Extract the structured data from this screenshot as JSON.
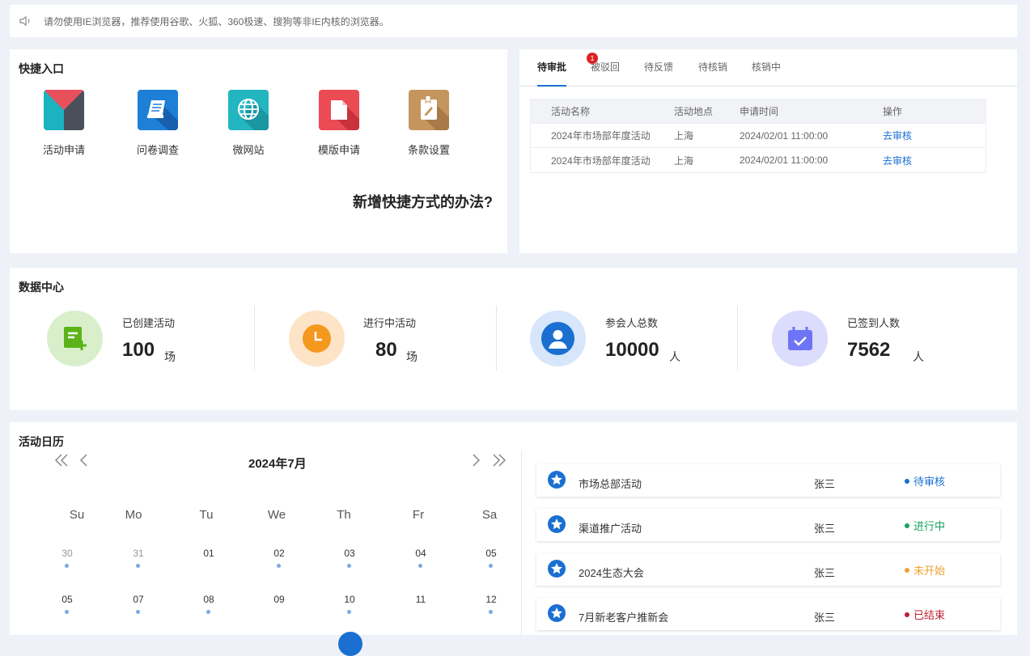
{
  "notice": {
    "text": "请勿使用IE浏览器，推荐使用谷歌、火狐、360极速、搜狗等非IE内核的浏览器。",
    "icon": "speaker-icon"
  },
  "quick": {
    "title": "快捷入口",
    "items": [
      {
        "label": "活动申请",
        "icon": "activity-icon"
      },
      {
        "label": "问卷调查",
        "icon": "survey-icon"
      },
      {
        "label": "微网站",
        "icon": "globe-icon"
      },
      {
        "label": "模版申请",
        "icon": "document-icon"
      },
      {
        "label": "条款设置",
        "icon": "terms-icon"
      }
    ],
    "how_link": "新增快捷方式的办法?"
  },
  "approval": {
    "tabs": [
      {
        "label": "待审批",
        "badge": "1",
        "active": true
      },
      {
        "label": "被驳回"
      },
      {
        "label": "待反馈"
      },
      {
        "label": "待核销"
      },
      {
        "label": "核销中"
      }
    ],
    "columns": [
      "活动名称",
      "活动地点",
      "申请时间",
      "操作"
    ],
    "rows": [
      {
        "name": "2024年市场部年度活动",
        "place": "上海",
        "time": "2024/02/01 11:00:00",
        "action": "去审核"
      },
      {
        "name": "2024年市场部年度活动",
        "place": "上海",
        "time": "2024/02/01 11:00:00",
        "action": "去审核"
      }
    ]
  },
  "data_center": {
    "title": "数据中心",
    "stats": [
      {
        "label": "已创建活动",
        "value": "100",
        "unit": "场",
        "icon": "create-activity-icon"
      },
      {
        "label": "进行中活动",
        "value": "80",
        "unit": "场",
        "icon": "clock-icon"
      },
      {
        "label": "参会人总数",
        "value": "10000",
        "unit": "人",
        "icon": "user-icon"
      },
      {
        "label": "已签到人数",
        "value": "7562",
        "unit": "人",
        "icon": "calendar-check-icon"
      }
    ]
  },
  "calendar": {
    "title": "活动日历",
    "month": "2024年7月",
    "weekdays": [
      "Su",
      "Mo",
      "Tu",
      "We",
      "Th",
      "Fr",
      "Sa"
    ],
    "week1": [
      "30",
      "31",
      "01",
      "02",
      "03",
      "04",
      "05"
    ],
    "week2": [
      "05",
      "07",
      "08",
      "09",
      "10",
      "11",
      "12"
    ],
    "events": [
      {
        "name": "市场总部活动",
        "owner": "张三",
        "status": "待审核",
        "color": "#1a6fd1"
      },
      {
        "name": "渠道推广活动",
        "owner": "张三",
        "status": "进行中",
        "color": "#19a15f"
      },
      {
        "name": "2024生态大会",
        "owner": "张三",
        "status": "未开始",
        "color": "#f0a030"
      },
      {
        "name": "7月新老客户推新会",
        "owner": "张三",
        "status": "已结束",
        "color": "#c0202f"
      }
    ]
  }
}
